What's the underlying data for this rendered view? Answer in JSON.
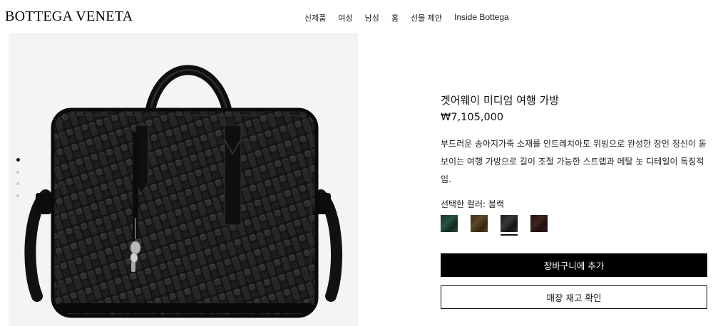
{
  "header": {
    "logo": "BOTTEGA VENETA",
    "nav": [
      "신제품",
      "여성",
      "남성",
      "홈",
      "선물 제안",
      "Inside Bottega"
    ]
  },
  "gallery": {
    "image": "black-intrecciato-leather-briefcase-bag",
    "slide_count": 4,
    "active_slide": 1
  },
  "product": {
    "title": "겟어웨이 미디엄 여행 가방",
    "price": "₩7,105,000",
    "description": "부드러운 송아지가죽 소재를 인트레치아토 위빙으로 완성한 장인 정신이 돋보이는 여행 가방으로 길이 조절 가능한 스트랩과 메탈 놋 디테일이 특징적임.",
    "color_label": "선택한 컬러: 블랙",
    "colors": [
      {
        "name": "green",
        "hex": "#1f3d2e"
      },
      {
        "name": "brown",
        "hex": "#4d3a1f"
      },
      {
        "name": "black",
        "hex": "#222222",
        "selected": true
      },
      {
        "name": "dark-brown",
        "hex": "#2e1a17"
      }
    ],
    "add_to_cart": "장바구니에 추가",
    "check_store": "매장 재고 확인"
  }
}
